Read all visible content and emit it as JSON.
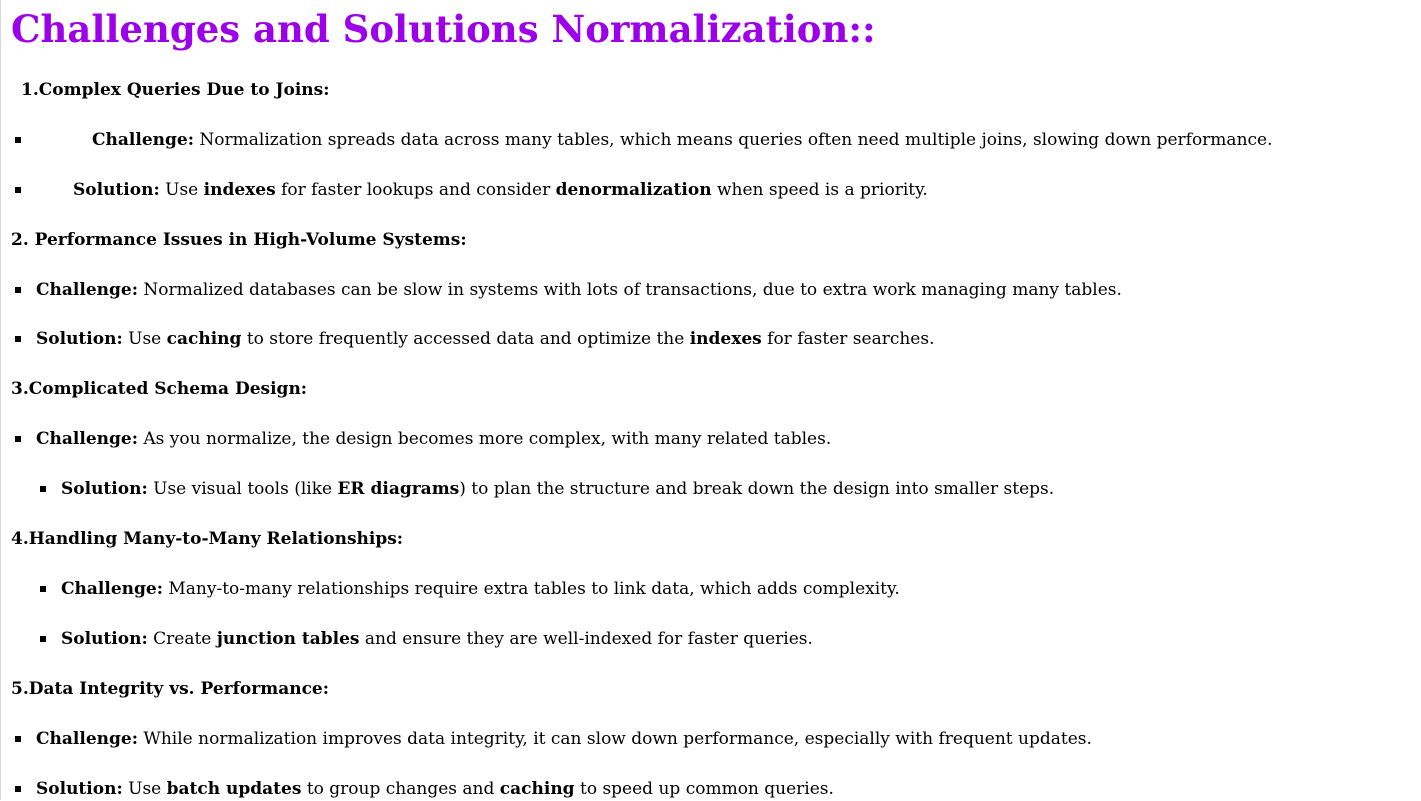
{
  "title": {
    "text": "Challenges and Solutions Normalization::",
    "color": "#9b00e8"
  },
  "sections": [
    {
      "heading": "1.Complex Queries Due to Joins:",
      "items": [
        {
          "label": "Challenge:",
          "segments": [
            {
              "text": " Normalization spreads data across many tables, which means queries often need multiple joins, slowing down performance.",
              "bold": false
            }
          ]
        },
        {
          "label": "Solution:",
          "segments": [
            {
              "text": " Use ",
              "bold": false
            },
            {
              "text": "indexes",
              "bold": true
            },
            {
              "text": " for faster lookups and consider ",
              "bold": false
            },
            {
              "text": "denormalization",
              "bold": true
            },
            {
              "text": " when speed is a priority.",
              "bold": false
            }
          ]
        }
      ]
    },
    {
      "heading": "2. Performance Issues in High-Volume Systems:",
      "items": [
        {
          "label": "Challenge:",
          "segments": [
            {
              "text": " Normalized databases can be slow in systems with lots of transactions, due to extra work managing many tables.",
              "bold": false
            }
          ]
        },
        {
          "label": "Solution:",
          "segments": [
            {
              "text": " Use ",
              "bold": false
            },
            {
              "text": "caching",
              "bold": true
            },
            {
              "text": " to store frequently accessed data and optimize the ",
              "bold": false
            },
            {
              "text": "indexes",
              "bold": true
            },
            {
              "text": " for faster searches.",
              "bold": false
            }
          ]
        }
      ]
    },
    {
      "heading": "3.Complicated Schema Design:",
      "items": [
        {
          "label": "Challenge:",
          "segments": [
            {
              "text": " As you normalize, the design becomes more complex, with many related tables.",
              "bold": false
            }
          ]
        },
        {
          "label": "Solution:",
          "segments": [
            {
              "text": " Use visual tools (like ",
              "bold": false
            },
            {
              "text": "ER diagrams",
              "bold": true
            },
            {
              "text": ") to plan the structure and break down the design into smaller steps.",
              "bold": false
            }
          ]
        }
      ]
    },
    {
      "heading": "4.Handling Many-to-Many Relationships:",
      "items": [
        {
          "label": "Challenge:",
          "segments": [
            {
              "text": " Many-to-many relationships require extra tables to link data, which adds complexity.",
              "bold": false
            }
          ]
        },
        {
          "label": "Solution:",
          "segments": [
            {
              "text": " Create ",
              "bold": false
            },
            {
              "text": "junction tables",
              "bold": true
            },
            {
              "text": " and ensure they are well-indexed for faster queries.",
              "bold": false
            }
          ]
        }
      ]
    },
    {
      "heading": "5.Data Integrity vs. Performance:",
      "items": [
        {
          "label": "Challenge:",
          "segments": [
            {
              "text": " While normalization improves data integrity, it can slow down performance, especially with frequent updates.",
              "bold": false
            }
          ]
        },
        {
          "label": "Solution:",
          "segments": [
            {
              "text": " Use ",
              "bold": false
            },
            {
              "text": "batch updates",
              "bold": true
            },
            {
              "text": " to group changes and ",
              "bold": false
            },
            {
              "text": "caching",
              "bold": true
            },
            {
              "text": " to speed up common queries.",
              "bold": false
            }
          ]
        }
      ]
    }
  ]
}
